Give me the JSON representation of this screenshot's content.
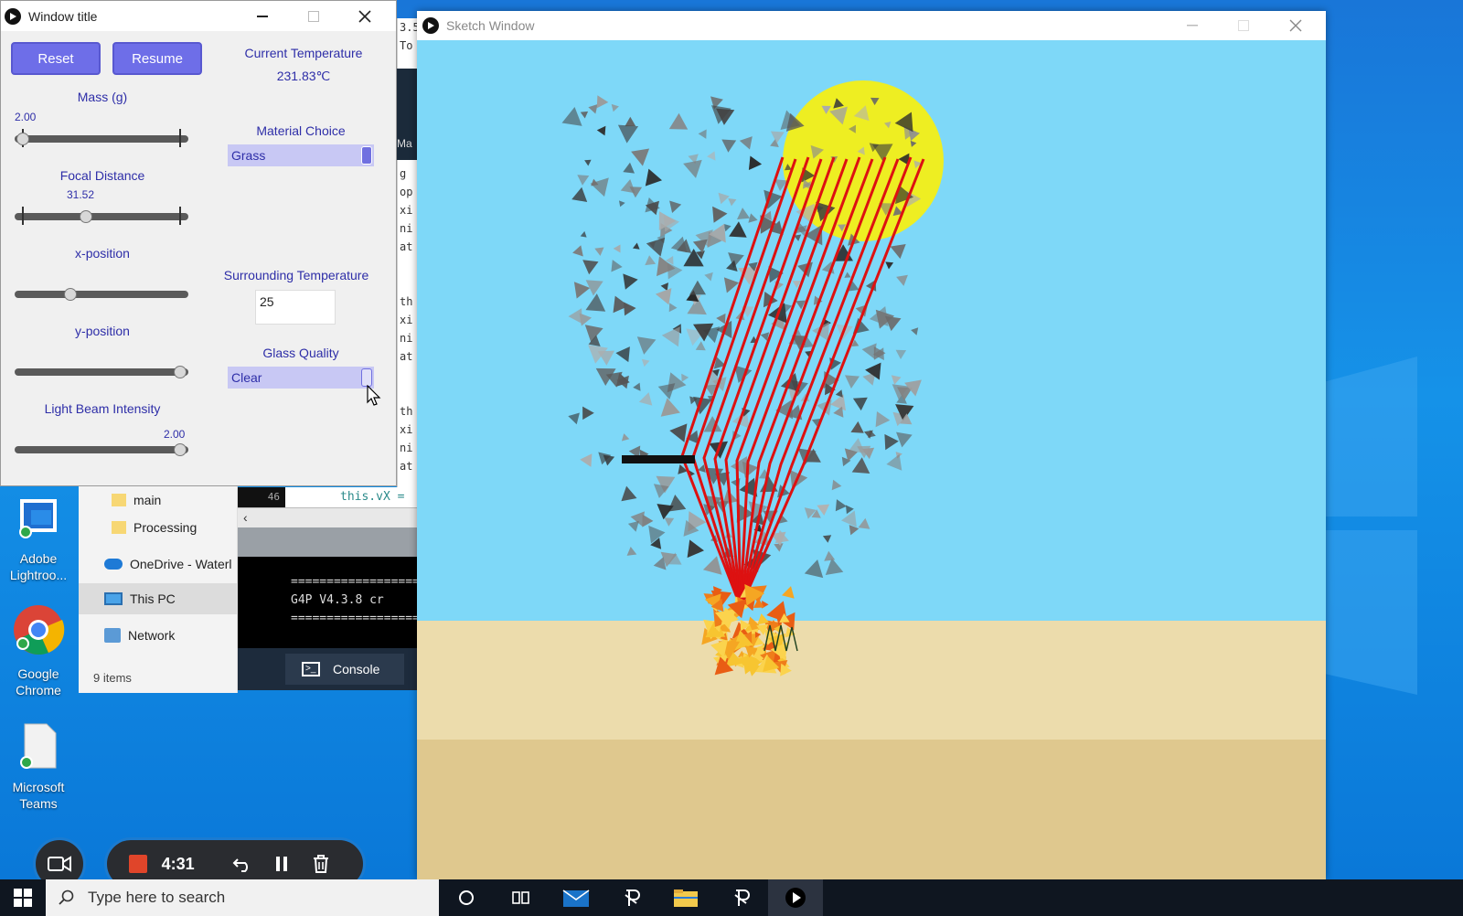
{
  "control_window": {
    "title": "Window title",
    "reset_label": "Reset",
    "resume_label": "Resume",
    "current_temp_label": "Current Temperature",
    "current_temp_value": "231.83℃",
    "mass_label": "Mass (g)",
    "mass_value": "2.00",
    "mass_level": 0.0,
    "focal_label": "Focal Distance",
    "focal_value": "31.52",
    "focal_level": 0.4,
    "xpos_label": "x-position",
    "xpos_level": 0.3,
    "ypos_label": "y-position",
    "ypos_level": 1.0,
    "beam_label": "Light Beam Intensity",
    "beam_value": "2.00",
    "beam_level": 1.0,
    "material_label": "Material Choice",
    "material_value": "Grass",
    "surround_label": "Surrounding Temperature",
    "surround_value": "25",
    "glass_label": "Glass Quality",
    "glass_value": "Clear"
  },
  "sketch_window": {
    "title": "Sketch Window"
  },
  "explorer": {
    "items": [
      {
        "label": "main",
        "icon": "folder-icon"
      },
      {
        "label": "Processing",
        "icon": "folder-icon"
      },
      {
        "label": "OneDrive - Waterl",
        "icon": "cloud-icon"
      },
      {
        "label": "This PC",
        "icon": "computer-icon"
      },
      {
        "label": "Network",
        "icon": "network-icon"
      }
    ],
    "status": "9 items"
  },
  "ide": {
    "line_number": "46",
    "code_snippet": "this.vX =",
    "console_line1": "==================",
    "console_line2": "G4P V4.3.8 cr",
    "console_line3": "==================",
    "console_tab": "Console",
    "side_fragments": [
      "3.5",
      "To",
      "Ma",
      "g",
      "op",
      "xi",
      "ni",
      "at",
      "th",
      "xi",
      "ni",
      "at",
      "th",
      "xi",
      "ni",
      "at"
    ]
  },
  "desktop_icons": [
    {
      "label": "Adobe Lightroo...",
      "icon": "lightroom-icon"
    },
    {
      "label": "Google Chrome",
      "icon": "chrome-icon"
    },
    {
      "label": "Microsoft Teams",
      "icon": "file-icon"
    }
  ],
  "recorder": {
    "time": "4:31"
  },
  "taskbar": {
    "search_placeholder": "Type here to search"
  },
  "colors": {
    "sky": "#7ed8f8",
    "sand": "#ead9a8",
    "sun": "#eeee22",
    "beam": "#dd1111",
    "g4p_button": "#6e6ee8"
  }
}
